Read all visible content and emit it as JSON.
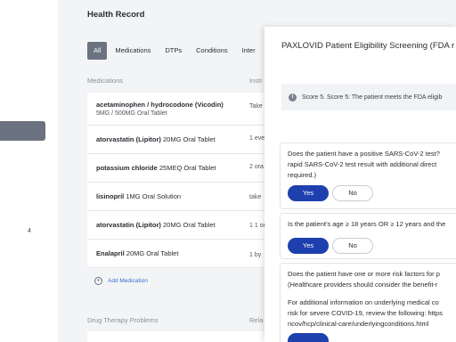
{
  "nav": {
    "count": "4"
  },
  "main": {
    "title": "Health Record",
    "tabs": [
      "All",
      "Medications",
      "DTPs",
      "Conditions",
      "Inter"
    ],
    "medications_header": "Medications",
    "instructions_header": "Instr",
    "medications": [
      {
        "name": "acetaminophen / hydrocodone (Vicodin)",
        "dose": "5MG / 500MG Oral Tablet",
        "instr": "Take"
      },
      {
        "name": "atorvastatin (Lipitor)",
        "dose": "20MG Oral Tablet",
        "instr": "1 eve"
      },
      {
        "name": "potassium chloride",
        "dose": "25MEQ Oral Tablet",
        "instr": "2 ora"
      },
      {
        "name": "lisinopril",
        "dose": "1MG Oral Solution",
        "instr": "take"
      },
      {
        "name": "atorvastatin (Lipitor)",
        "dose": "20MG Oral Tablet",
        "instr": "1 1 or"
      },
      {
        "name": "Enalapril",
        "dose": "20MG Oral Tablet",
        "instr": "1 by"
      }
    ],
    "add_medication": "Add Medication",
    "dtp_header": "Drug Therapy Problems",
    "dtp_relation_header": "Rela"
  },
  "panel": {
    "title": "PAXLOVID Patient Eligibility Screening (FDA r",
    "score": "Score 5. Score 5: The patient meets the FDA eligib",
    "questions": [
      {
        "lines": [
          "Does the patient have a positive SARS-CoV-2 test?",
          "rapid SARS-CoV-2 test result with additional direct",
          "required.)"
        ],
        "yes": "Yes",
        "no": "No",
        "selected": "yes"
      },
      {
        "lines": [
          "Is the patient's age ≥ 18 years OR ≥ 12 years and the"
        ],
        "yes": "Yes",
        "no": "No",
        "selected": "yes"
      },
      {
        "lines": [
          "Does the patient have one or more risk factors for p",
          "(Healthcare providers should consider the benefit-r",
          "",
          "For additional information on underlying medical co",
          "risk for severe COVID-19, review the following: https",
          "ncov/hcp/clinical-care/underlyingconditions.html"
        ]
      }
    ]
  }
}
